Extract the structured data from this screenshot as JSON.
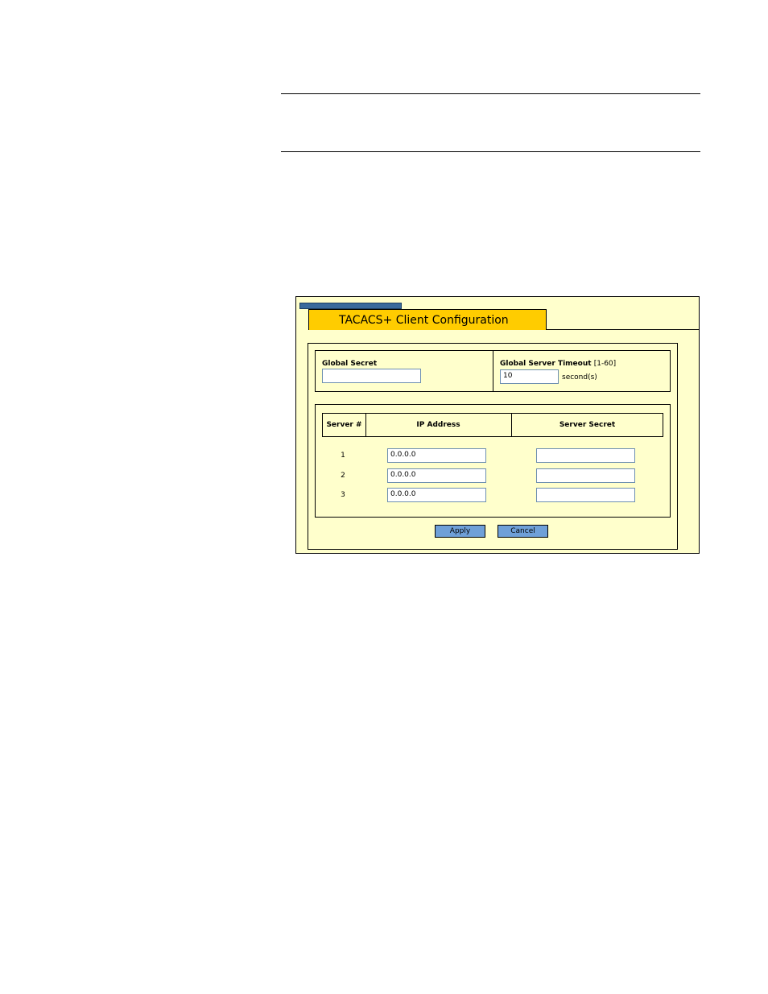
{
  "window": {
    "title": "TACACS+ Client Configuration"
  },
  "globals": {
    "secret_label": "Global Secret",
    "secret_value": "",
    "timeout_label": "Global Server Timeout",
    "timeout_range": "[1-60]",
    "timeout_value": "10",
    "timeout_unit": "second(s)"
  },
  "servers": {
    "headers": [
      "Server #",
      "IP Address",
      "Server Secret"
    ],
    "rows": [
      {
        "num": "1",
        "ip": "0.0.0.0",
        "secret": ""
      },
      {
        "num": "2",
        "ip": "0.0.0.0",
        "secret": ""
      },
      {
        "num": "3",
        "ip": "0.0.0.0",
        "secret": ""
      }
    ]
  },
  "actions": {
    "apply_label": "Apply",
    "cancel_label": "Cancel"
  },
  "colors": {
    "background": "#ffffcc",
    "title_tab": "#ffcc00",
    "tab_bar": "#3a6a9c",
    "button": "#6fa0d8",
    "input_border": "#6d8fb0"
  }
}
